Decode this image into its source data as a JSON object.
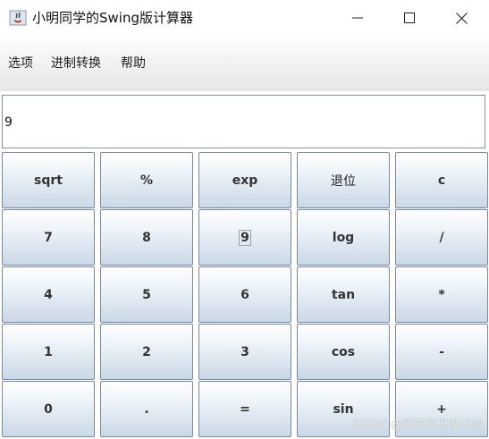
{
  "window": {
    "title": "小明同学的Swing版计算器",
    "icon": "java-cup-icon"
  },
  "menu": {
    "items": [
      "选项",
      "进制转换",
      "帮助"
    ]
  },
  "display": {
    "value": "9"
  },
  "keypad": {
    "rows": [
      [
        "sqrt",
        "%",
        "exp",
        "退位",
        "c"
      ],
      [
        "7",
        "8",
        "9",
        "log",
        "/"
      ],
      [
        "4",
        "5",
        "6",
        "tan",
        "*"
      ],
      [
        "1",
        "2",
        "3",
        "cos",
        "-"
      ],
      [
        "0",
        ".",
        "=",
        "sin",
        "+"
      ]
    ]
  },
  "watermark": "CSDN @阳光宅男技术站"
}
